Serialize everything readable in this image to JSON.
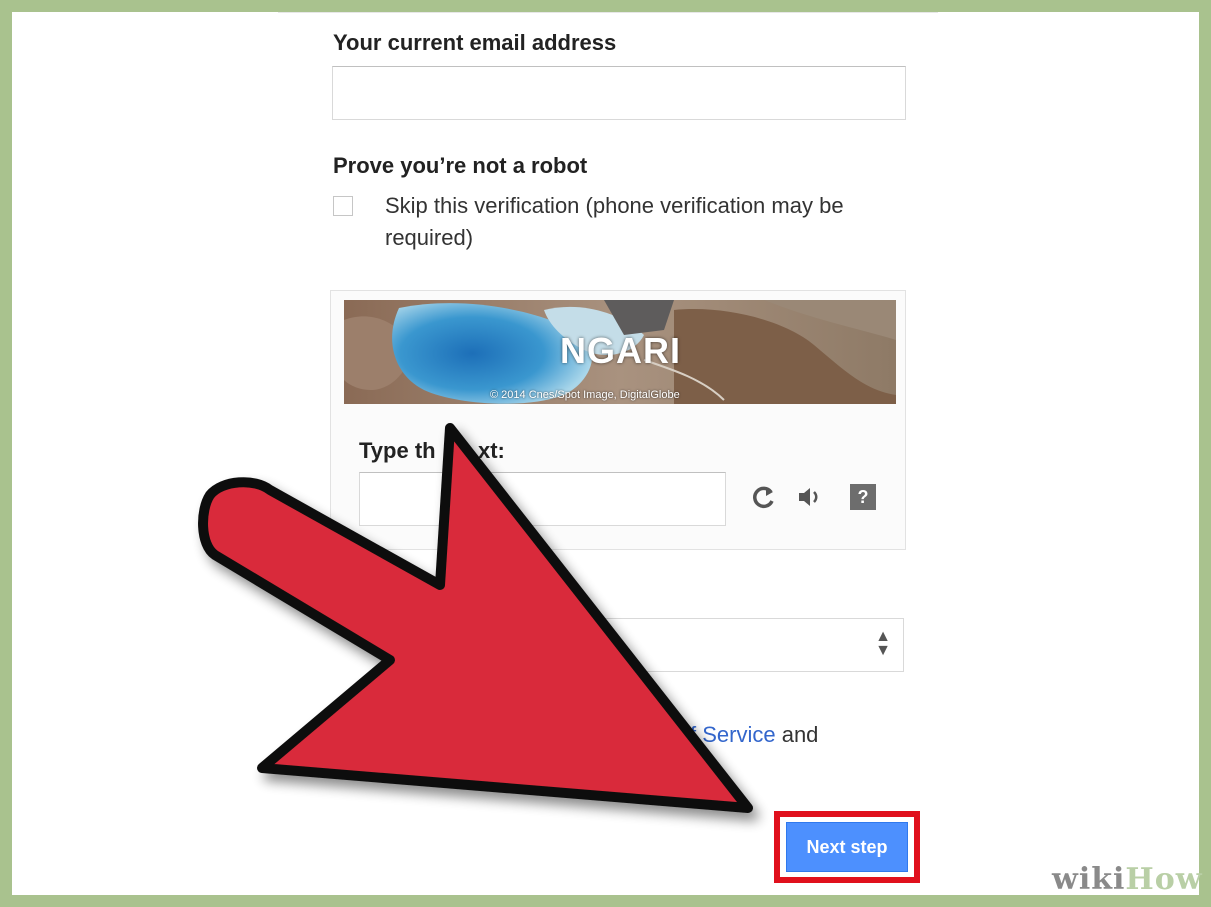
{
  "form": {
    "email_label": "Your current email address",
    "email_value": "",
    "robot_label": "Prove you’re not a robot",
    "skip_line1": "Skip this verification (phone verification may be",
    "skip_line2": "required)",
    "skip_checked": false
  },
  "captcha": {
    "word": "NGARI",
    "copyright": "© 2014 Cnes/Spot Image, DigitalGlobe",
    "prompt_visible_a": "Type th",
    "prompt_visible_b": "xt:",
    "input_value": "",
    "icons": [
      "refresh-icon",
      "audio-icon",
      "help-icon"
    ],
    "help_glyph": "?"
  },
  "location": {
    "selected_value": ""
  },
  "terms": {
    "link_partial": "f Service",
    "trailing": " and"
  },
  "next_button": {
    "label": "Next step",
    "color": "#4d90fe",
    "highlight_color": "#e0101d"
  },
  "overlay": {
    "arrow_color": "#d92b3a",
    "arrow_outline": "#111111"
  },
  "watermark": {
    "part1": "wiki",
    "part2": "How"
  }
}
